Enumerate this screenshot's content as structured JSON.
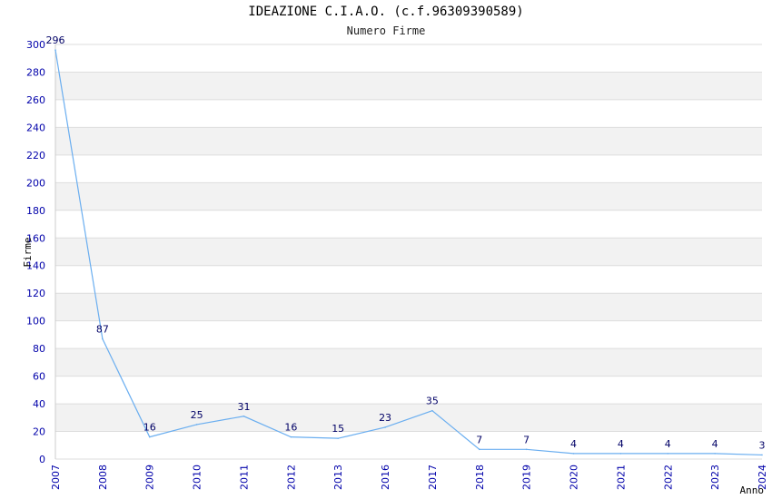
{
  "chart_data": {
    "type": "line",
    "title": "IDEAZIONE C.I.A.O. (c.f.96309390589)",
    "subtitle": "Numero Firme",
    "xlabel": "Anno",
    "ylabel": "Firme",
    "categories": [
      "2007",
      "2008",
      "2009",
      "2010",
      "2011",
      "2012",
      "2013",
      "2016",
      "2017",
      "2018",
      "2019",
      "2020",
      "2021",
      "2022",
      "2023",
      "2024"
    ],
    "values": [
      296,
      87,
      16,
      25,
      31,
      16,
      15,
      23,
      35,
      7,
      7,
      4,
      4,
      4,
      4,
      3
    ],
    "ylim": [
      0,
      300
    ],
    "yticks": [
      0,
      20,
      40,
      60,
      80,
      100,
      120,
      140,
      160,
      180,
      200,
      220,
      240,
      260,
      280,
      300
    ],
    "grid": "horizontal bands",
    "colors": {
      "line": "#6aaef0",
      "band": "#f2f2f2",
      "ticks": "#0000aa",
      "data_labels": "#000066"
    }
  }
}
